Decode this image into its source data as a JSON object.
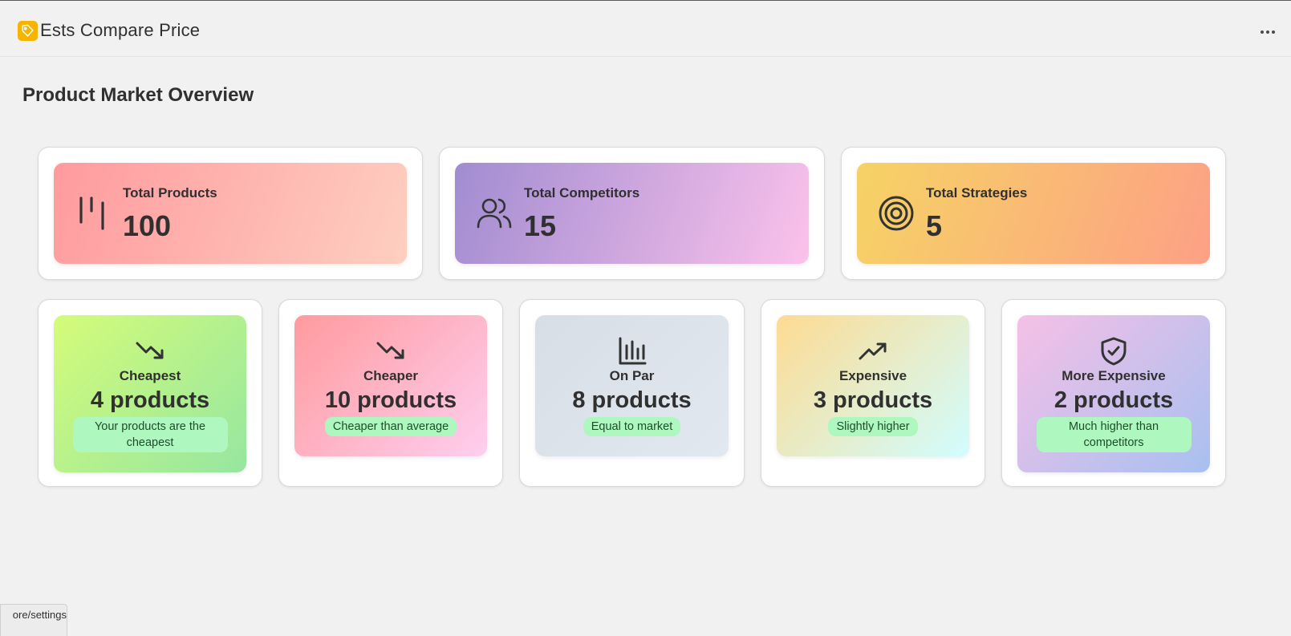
{
  "app": {
    "title": "Ests Compare Price",
    "logo_icon": "tag-icon",
    "more_icon": "more-horizontal-icon"
  },
  "page": {
    "title": "Product Market Overview"
  },
  "stats": [
    {
      "label": "Total Products",
      "value": "100",
      "icon": "barcode-icon",
      "gradient": [
        "#ff9a9e",
        "#fecfc0"
      ]
    },
    {
      "label": "Total Competitors",
      "value": "15",
      "icon": "users-icon",
      "gradient": [
        "#a18cd1",
        "#fbc2eb"
      ]
    },
    {
      "label": "Total Strategies",
      "value": "5",
      "icon": "target-icon",
      "gradient": [
        "#f6d365",
        "#fda085"
      ]
    }
  ],
  "tiers": [
    {
      "label": "Cheapest",
      "count": "4 products",
      "badge": "Your products are the cheapest",
      "icon": "trending-down-icon",
      "gradient": [
        "#d4fc79",
        "#96e6a1"
      ]
    },
    {
      "label": "Cheaper",
      "count": "10 products",
      "badge": "Cheaper than average",
      "icon": "trending-down-icon",
      "gradient": [
        "#ff9a9e",
        "#fecfef"
      ]
    },
    {
      "label": "On Par",
      "count": "8 products",
      "badge": "Equal to market",
      "icon": "bar-chart-icon",
      "gradient": [
        "#d7dee6",
        "#e2e8ef"
      ]
    },
    {
      "label": "Expensive",
      "count": "3 products",
      "badge": "Slightly higher",
      "icon": "trending-up-icon",
      "gradient": [
        "#fddb92",
        "#d1fdff"
      ]
    },
    {
      "label": "More Expensive",
      "count": "2 products",
      "badge": "Much higher than competitors",
      "icon": "shield-check-icon",
      "gradient": [
        "#f5c0e6",
        "#a8c0f0"
      ]
    }
  ],
  "status_bar": {
    "url": "ore/settings"
  }
}
